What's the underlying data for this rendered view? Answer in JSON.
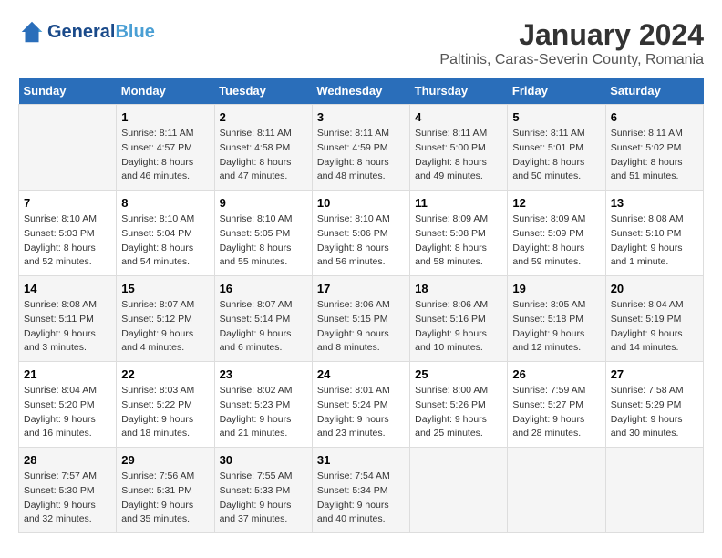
{
  "header": {
    "logo_line1": "General",
    "logo_line2": "Blue",
    "main_title": "January 2024",
    "subtitle": "Paltinis, Caras-Severin County, Romania"
  },
  "weekdays": [
    "Sunday",
    "Monday",
    "Tuesday",
    "Wednesday",
    "Thursday",
    "Friday",
    "Saturday"
  ],
  "weeks": [
    [
      {
        "day": "",
        "sunrise": "",
        "sunset": "",
        "daylight": ""
      },
      {
        "day": "1",
        "sunrise": "Sunrise: 8:11 AM",
        "sunset": "Sunset: 4:57 PM",
        "daylight": "Daylight: 8 hours and 46 minutes."
      },
      {
        "day": "2",
        "sunrise": "Sunrise: 8:11 AM",
        "sunset": "Sunset: 4:58 PM",
        "daylight": "Daylight: 8 hours and 47 minutes."
      },
      {
        "day": "3",
        "sunrise": "Sunrise: 8:11 AM",
        "sunset": "Sunset: 4:59 PM",
        "daylight": "Daylight: 8 hours and 48 minutes."
      },
      {
        "day": "4",
        "sunrise": "Sunrise: 8:11 AM",
        "sunset": "Sunset: 5:00 PM",
        "daylight": "Daylight: 8 hours and 49 minutes."
      },
      {
        "day": "5",
        "sunrise": "Sunrise: 8:11 AM",
        "sunset": "Sunset: 5:01 PM",
        "daylight": "Daylight: 8 hours and 50 minutes."
      },
      {
        "day": "6",
        "sunrise": "Sunrise: 8:11 AM",
        "sunset": "Sunset: 5:02 PM",
        "daylight": "Daylight: 8 hours and 51 minutes."
      }
    ],
    [
      {
        "day": "7",
        "sunrise": "Sunrise: 8:10 AM",
        "sunset": "Sunset: 5:03 PM",
        "daylight": "Daylight: 8 hours and 52 minutes."
      },
      {
        "day": "8",
        "sunrise": "Sunrise: 8:10 AM",
        "sunset": "Sunset: 5:04 PM",
        "daylight": "Daylight: 8 hours and 54 minutes."
      },
      {
        "day": "9",
        "sunrise": "Sunrise: 8:10 AM",
        "sunset": "Sunset: 5:05 PM",
        "daylight": "Daylight: 8 hours and 55 minutes."
      },
      {
        "day": "10",
        "sunrise": "Sunrise: 8:10 AM",
        "sunset": "Sunset: 5:06 PM",
        "daylight": "Daylight: 8 hours and 56 minutes."
      },
      {
        "day": "11",
        "sunrise": "Sunrise: 8:09 AM",
        "sunset": "Sunset: 5:08 PM",
        "daylight": "Daylight: 8 hours and 58 minutes."
      },
      {
        "day": "12",
        "sunrise": "Sunrise: 8:09 AM",
        "sunset": "Sunset: 5:09 PM",
        "daylight": "Daylight: 8 hours and 59 minutes."
      },
      {
        "day": "13",
        "sunrise": "Sunrise: 8:08 AM",
        "sunset": "Sunset: 5:10 PM",
        "daylight": "Daylight: 9 hours and 1 minute."
      }
    ],
    [
      {
        "day": "14",
        "sunrise": "Sunrise: 8:08 AM",
        "sunset": "Sunset: 5:11 PM",
        "daylight": "Daylight: 9 hours and 3 minutes."
      },
      {
        "day": "15",
        "sunrise": "Sunrise: 8:07 AM",
        "sunset": "Sunset: 5:12 PM",
        "daylight": "Daylight: 9 hours and 4 minutes."
      },
      {
        "day": "16",
        "sunrise": "Sunrise: 8:07 AM",
        "sunset": "Sunset: 5:14 PM",
        "daylight": "Daylight: 9 hours and 6 minutes."
      },
      {
        "day": "17",
        "sunrise": "Sunrise: 8:06 AM",
        "sunset": "Sunset: 5:15 PM",
        "daylight": "Daylight: 9 hours and 8 minutes."
      },
      {
        "day": "18",
        "sunrise": "Sunrise: 8:06 AM",
        "sunset": "Sunset: 5:16 PM",
        "daylight": "Daylight: 9 hours and 10 minutes."
      },
      {
        "day": "19",
        "sunrise": "Sunrise: 8:05 AM",
        "sunset": "Sunset: 5:18 PM",
        "daylight": "Daylight: 9 hours and 12 minutes."
      },
      {
        "day": "20",
        "sunrise": "Sunrise: 8:04 AM",
        "sunset": "Sunset: 5:19 PM",
        "daylight": "Daylight: 9 hours and 14 minutes."
      }
    ],
    [
      {
        "day": "21",
        "sunrise": "Sunrise: 8:04 AM",
        "sunset": "Sunset: 5:20 PM",
        "daylight": "Daylight: 9 hours and 16 minutes."
      },
      {
        "day": "22",
        "sunrise": "Sunrise: 8:03 AM",
        "sunset": "Sunset: 5:22 PM",
        "daylight": "Daylight: 9 hours and 18 minutes."
      },
      {
        "day": "23",
        "sunrise": "Sunrise: 8:02 AM",
        "sunset": "Sunset: 5:23 PM",
        "daylight": "Daylight: 9 hours and 21 minutes."
      },
      {
        "day": "24",
        "sunrise": "Sunrise: 8:01 AM",
        "sunset": "Sunset: 5:24 PM",
        "daylight": "Daylight: 9 hours and 23 minutes."
      },
      {
        "day": "25",
        "sunrise": "Sunrise: 8:00 AM",
        "sunset": "Sunset: 5:26 PM",
        "daylight": "Daylight: 9 hours and 25 minutes."
      },
      {
        "day": "26",
        "sunrise": "Sunrise: 7:59 AM",
        "sunset": "Sunset: 5:27 PM",
        "daylight": "Daylight: 9 hours and 28 minutes."
      },
      {
        "day": "27",
        "sunrise": "Sunrise: 7:58 AM",
        "sunset": "Sunset: 5:29 PM",
        "daylight": "Daylight: 9 hours and 30 minutes."
      }
    ],
    [
      {
        "day": "28",
        "sunrise": "Sunrise: 7:57 AM",
        "sunset": "Sunset: 5:30 PM",
        "daylight": "Daylight: 9 hours and 32 minutes."
      },
      {
        "day": "29",
        "sunrise": "Sunrise: 7:56 AM",
        "sunset": "Sunset: 5:31 PM",
        "daylight": "Daylight: 9 hours and 35 minutes."
      },
      {
        "day": "30",
        "sunrise": "Sunrise: 7:55 AM",
        "sunset": "Sunset: 5:33 PM",
        "daylight": "Daylight: 9 hours and 37 minutes."
      },
      {
        "day": "31",
        "sunrise": "Sunrise: 7:54 AM",
        "sunset": "Sunset: 5:34 PM",
        "daylight": "Daylight: 9 hours and 40 minutes."
      },
      {
        "day": "",
        "sunrise": "",
        "sunset": "",
        "daylight": ""
      },
      {
        "day": "",
        "sunrise": "",
        "sunset": "",
        "daylight": ""
      },
      {
        "day": "",
        "sunrise": "",
        "sunset": "",
        "daylight": ""
      }
    ]
  ]
}
